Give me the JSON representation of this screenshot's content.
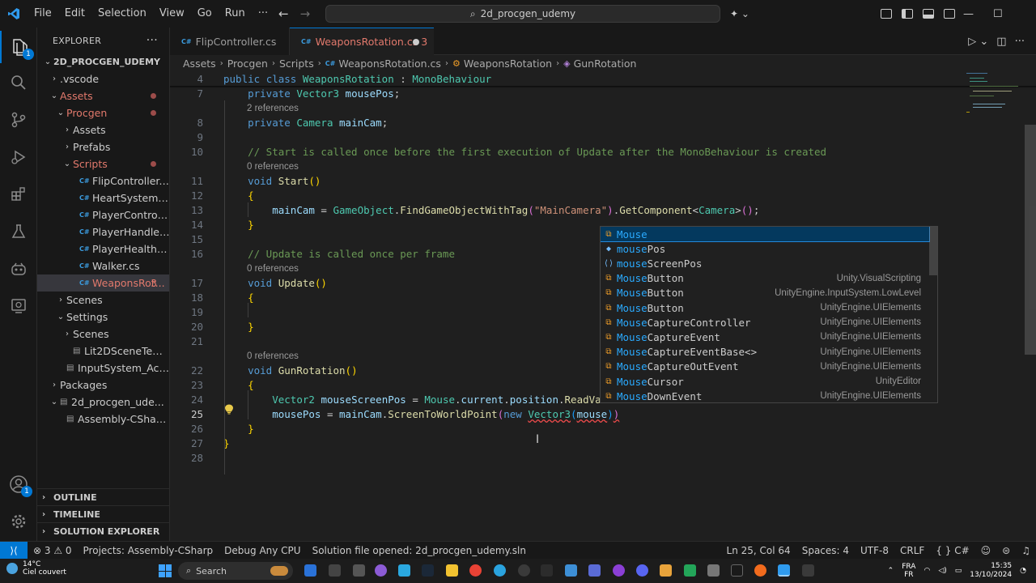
{
  "titlebar": {
    "menus": [
      "File",
      "Edit",
      "Selection",
      "View",
      "Go",
      "Run",
      "···"
    ],
    "search": "2d_procgen_udemy"
  },
  "activitybar": {
    "items": [
      "explorer-icon",
      "search-icon",
      "source-control-icon",
      "run-debug-icon",
      "extensions-icon",
      "testing-icon",
      "copilot-icon",
      "remote-explorer-icon"
    ],
    "explorer_badge": "1",
    "account_badge": "1"
  },
  "sidebar": {
    "title": "EXPLORER",
    "more": "···",
    "tree": [
      {
        "label": "2D_PROCGEN_UDEMY",
        "indent": 0,
        "chev": "⌄",
        "bold": true
      },
      {
        "label": ".vscode",
        "indent": 1,
        "chev": "›"
      },
      {
        "label": "Assets",
        "indent": 1,
        "chev": "⌄",
        "mod": true,
        "dot": true
      },
      {
        "label": "Procgen",
        "indent": 2,
        "chev": "⌄",
        "mod": true,
        "dot": true
      },
      {
        "label": "Assets",
        "indent": 3,
        "chev": "›"
      },
      {
        "label": "Prefabs",
        "indent": 3,
        "chev": "›"
      },
      {
        "label": "Scripts",
        "indent": 3,
        "chev": "⌄",
        "mod": true,
        "dot": true
      },
      {
        "label": "FlipController.cs",
        "indent": 4,
        "cs": true
      },
      {
        "label": "HeartSystem.cs",
        "indent": 4,
        "cs": true
      },
      {
        "label": "PlayerController.cs",
        "indent": 4,
        "cs": true
      },
      {
        "label": "PlayerHandler.cs",
        "indent": 4,
        "cs": true
      },
      {
        "label": "PlayerHealth.cs",
        "indent": 4,
        "cs": true
      },
      {
        "label": "Walker.cs",
        "indent": 4,
        "cs": true
      },
      {
        "label": "WeaponsRot...",
        "indent": 4,
        "cs": true,
        "mod": true,
        "count": "3",
        "selected": true
      },
      {
        "label": "Scenes",
        "indent": 2,
        "chev": "›"
      },
      {
        "label": "Settings",
        "indent": 2,
        "chev": "⌄"
      },
      {
        "label": "Scenes",
        "indent": 3,
        "chev": "›"
      },
      {
        "label": "Lit2DSceneTemplat...",
        "indent": 3,
        "file": true
      },
      {
        "label": "InputSystem_Action...",
        "indent": 2,
        "file": true
      },
      {
        "label": "Packages",
        "indent": 1,
        "chev": "›"
      },
      {
        "label": "2d_procgen_ude...",
        "indent": 1,
        "chev": "⌄",
        "file": true
      },
      {
        "label": "Assembly-CSharp...",
        "indent": 2,
        "file": true
      }
    ],
    "sections": [
      "OUTLINE",
      "TIMELINE",
      "SOLUTION EXPLORER"
    ]
  },
  "tabs": [
    {
      "label": "FlipController.cs"
    },
    {
      "label": "WeaponsRotation.cs",
      "count": "3"
    }
  ],
  "breadcrumb": [
    "Assets",
    "Procgen",
    "Scripts",
    "WeaponsRotation.cs",
    "WeaponsRotation",
    "GunRotation"
  ],
  "editor": {
    "lines": [
      {
        "n": "4",
        "sticky": true,
        "tokens": [
          [
            "kw",
            "public "
          ],
          [
            "kw",
            "class "
          ],
          [
            "ty",
            "WeaponsRotation"
          ],
          [
            "pu",
            " : "
          ],
          [
            "ty",
            "MonoBehaviour"
          ]
        ]
      },
      {
        "n": "7",
        "tokens": [
          [
            "pu",
            "    "
          ],
          [
            "kw",
            "private "
          ],
          [
            "ty",
            "Vector3 "
          ],
          [
            "va",
            "mousePos"
          ],
          [
            "pu",
            ";"
          ]
        ]
      },
      {
        "lens": "2 references"
      },
      {
        "n": "8",
        "tokens": [
          [
            "pu",
            "    "
          ],
          [
            "kw",
            "private "
          ],
          [
            "ty",
            "Camera "
          ],
          [
            "va",
            "mainCam"
          ],
          [
            "pu",
            ";"
          ]
        ]
      },
      {
        "n": "9",
        "tokens": []
      },
      {
        "n": "10",
        "tokens": [
          [
            "pu",
            "    "
          ],
          [
            "cm",
            "// Start is called once before the first execution of Update after the MonoBehaviour is created"
          ]
        ]
      },
      {
        "lens": "0 references"
      },
      {
        "n": "11",
        "tokens": [
          [
            "pu",
            "    "
          ],
          [
            "kw",
            "void "
          ],
          [
            "fn",
            "Start"
          ],
          [
            "br1",
            "()"
          ]
        ]
      },
      {
        "n": "12",
        "tokens": [
          [
            "pu",
            "    "
          ],
          [
            "br1",
            "{"
          ]
        ]
      },
      {
        "n": "13",
        "tokens": [
          [
            "pu",
            "        "
          ],
          [
            "va",
            "mainCam"
          ],
          [
            "pu",
            " = "
          ],
          [
            "ty",
            "GameObject"
          ],
          [
            "pu",
            "."
          ],
          [
            "fn",
            "FindGameObjectWithTag"
          ],
          [
            "br2",
            "("
          ],
          [
            "st",
            "\"MainCamera\""
          ],
          [
            "br2",
            ")"
          ],
          [
            "pu",
            "."
          ],
          [
            "fn",
            "GetComponent"
          ],
          [
            "pu",
            "<"
          ],
          [
            "ty",
            "Camera"
          ],
          [
            "pu",
            ">"
          ],
          [
            "br2",
            "()"
          ],
          [
            "pu",
            ";"
          ]
        ]
      },
      {
        "n": "14",
        "tokens": [
          [
            "pu",
            "    "
          ],
          [
            "br1",
            "}"
          ]
        ]
      },
      {
        "n": "15",
        "tokens": []
      },
      {
        "n": "16",
        "tokens": [
          [
            "pu",
            "    "
          ],
          [
            "cm",
            "// Update is called once per frame"
          ]
        ]
      },
      {
        "lens": "0 references"
      },
      {
        "n": "17",
        "tokens": [
          [
            "pu",
            "    "
          ],
          [
            "kw",
            "void "
          ],
          [
            "fn",
            "Update"
          ],
          [
            "br1",
            "()"
          ]
        ]
      },
      {
        "n": "18",
        "tokens": [
          [
            "pu",
            "    "
          ],
          [
            "br1",
            "{"
          ]
        ]
      },
      {
        "n": "19",
        "tokens": []
      },
      {
        "n": "20",
        "tokens": [
          [
            "pu",
            "    "
          ],
          [
            "br1",
            "}"
          ]
        ]
      },
      {
        "n": "21",
        "tokens": []
      },
      {
        "lens": "0 references"
      },
      {
        "n": "22",
        "tokens": [
          [
            "pu",
            "    "
          ],
          [
            "kw",
            "void "
          ],
          [
            "fn",
            "GunRotation"
          ],
          [
            "br1",
            "()"
          ]
        ]
      },
      {
        "n": "23",
        "tokens": [
          [
            "pu",
            "    "
          ],
          [
            "br1",
            "{"
          ]
        ]
      },
      {
        "n": "24",
        "tokens": [
          [
            "pu",
            "        "
          ],
          [
            "ty",
            "Vector2 "
          ],
          [
            "va",
            "mouseScreenPos"
          ],
          [
            "pu",
            " = "
          ],
          [
            "ty",
            "Mouse"
          ],
          [
            "pu",
            "."
          ],
          [
            "va",
            "current"
          ],
          [
            "pu",
            "."
          ],
          [
            "va",
            "position"
          ],
          [
            "pu",
            "."
          ],
          [
            "fn",
            "ReadVal"
          ]
        ]
      },
      {
        "n": "25",
        "cur": true,
        "tokens": [
          [
            "pu",
            "        "
          ],
          [
            "va",
            "mousePos"
          ],
          [
            "pu",
            " = "
          ],
          [
            "va",
            "mainCam"
          ],
          [
            "pu",
            "."
          ],
          [
            "fn",
            "ScreenToWorldPoint"
          ],
          [
            "br2",
            "("
          ],
          [
            "kw",
            "new "
          ],
          [
            "ty squig",
            "Vector3"
          ],
          [
            "br3",
            "("
          ],
          [
            "va squig",
            "mouse"
          ],
          [
            "br3",
            ")"
          ],
          [
            "br2 squig",
            ")"
          ]
        ]
      },
      {
        "n": "26",
        "tokens": [
          [
            "pu",
            "    "
          ],
          [
            "br1",
            "}"
          ]
        ]
      },
      {
        "n": "27",
        "tokens": [
          [
            "br1",
            "}"
          ]
        ]
      },
      {
        "n": "28",
        "tokens": []
      }
    ]
  },
  "suggest": {
    "items": [
      {
        "icon": "struct",
        "match": "Mouse",
        "rest": "",
        "detail": ""
      },
      {
        "icon": "field",
        "match": "mouse",
        "rest": "Pos",
        "detail": ""
      },
      {
        "icon": "var",
        "match": "mouse",
        "rest": "ScreenPos",
        "detail": ""
      },
      {
        "icon": "struct",
        "match": "Mouse",
        "rest": "Button",
        "detail": "Unity.VisualScripting"
      },
      {
        "icon": "struct",
        "match": "Mouse",
        "rest": "Button",
        "detail": "UnityEngine.InputSystem.LowLevel"
      },
      {
        "icon": "struct",
        "match": "Mouse",
        "rest": "Button",
        "detail": "UnityEngine.UIElements"
      },
      {
        "icon": "struct",
        "match": "Mouse",
        "rest": "CaptureController",
        "detail": "UnityEngine.UIElements"
      },
      {
        "icon": "struct",
        "match": "Mouse",
        "rest": "CaptureEvent",
        "detail": "UnityEngine.UIElements"
      },
      {
        "icon": "struct",
        "match": "Mouse",
        "rest": "CaptureEventBase<>",
        "detail": "UnityEngine.UIElements"
      },
      {
        "icon": "struct",
        "match": "Mouse",
        "rest": "CaptureOutEvent",
        "detail": "UnityEngine.UIElements"
      },
      {
        "icon": "struct",
        "match": "Mouse",
        "rest": "Cursor",
        "detail": "UnityEditor"
      },
      {
        "icon": "struct",
        "match": "Mouse",
        "rest": "DownEvent",
        "detail": "UnityEngine.UIElements"
      }
    ]
  },
  "statusbar": {
    "problems": "⊗ 3 ⚠ 0",
    "project": "Projects: Assembly-CSharp",
    "config": "Debug Any CPU",
    "solution": "Solution file opened: 2d_procgen_udemy.sln",
    "position": "Ln 25, Col 64",
    "spaces": "Spaces: 4",
    "encoding": "UTF-8",
    "eol": "CRLF",
    "language": "{ } C#"
  },
  "taskbar": {
    "temp": "14°C",
    "weather": "Ciel couvert",
    "search": "Search",
    "lang_top": "FRA",
    "lang_bottom": "FR",
    "time": "15:35",
    "date": "13/10/2024"
  }
}
